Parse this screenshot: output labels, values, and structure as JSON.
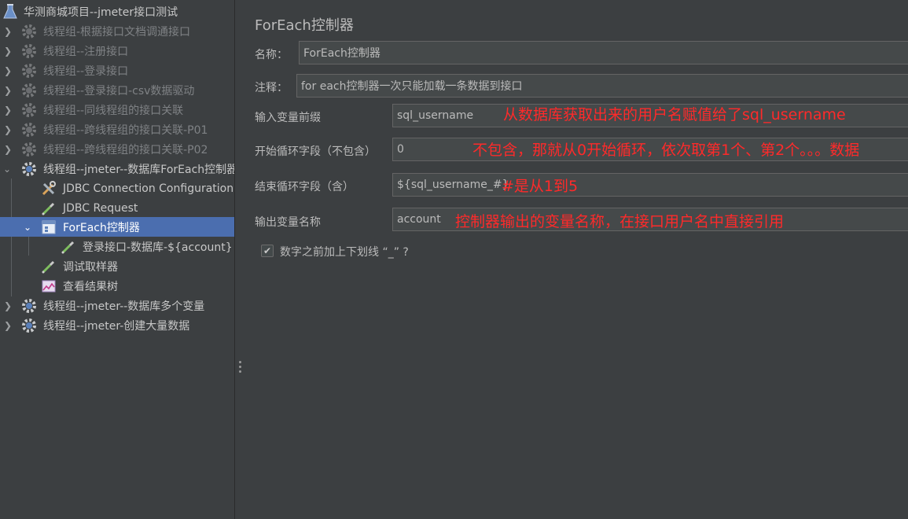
{
  "tree": {
    "root": "华测商城项目--jmeter接口测试",
    "thread_groups_top": [
      "线程组-根据接口文档调通接口",
      "线程组--注册接口",
      "线程组--登录接口",
      "线程组--登录接口-csv数据驱动",
      "线程组--同线程组的接口关联",
      "线程组--跨线程组的接口关联-P01",
      "线程组--跨线程组的接口关联-P02"
    ],
    "expanded_group": "线程组--jmeter--数据库ForEach控制器",
    "children": {
      "jdbc_config": "JDBC Connection Configuration",
      "jdbc_request": "JDBC Request",
      "foreach": "ForEach控制器",
      "login_sampler": "登录接口-数据库-${account}",
      "debug_sampler": "调试取样器",
      "result_tree": "查看结果树"
    },
    "thread_groups_bottom": [
      "线程组--jmeter--数据库多个变量",
      "线程组--jmeter-创建大量数据"
    ]
  },
  "panel": {
    "title": "ForEach控制器",
    "name_label": "名称：",
    "name_value": "ForEach控制器",
    "comment_label": "注释：",
    "comment_value": "for each控制器一次只能加载一条数据到接口",
    "input_prefix_label": "输入变量前缀",
    "input_prefix_value": "sql_username",
    "start_label": "开始循环字段（不包含）",
    "start_value": "0",
    "end_label": "结束循环字段（含）",
    "end_value": "${sql_username_#}",
    "output_label": "输出变量名称",
    "output_value": "account",
    "checkbox_label": "数字之前加上下划线 “_” ?",
    "checkbox_checked": true
  },
  "annotations": {
    "input_prefix": "从数据库获取出来的用户名赋值给了sql_username",
    "start": "不包含，那就从0开始循环，依次取第1个、第2个。。。数据",
    "end": "#是从1到5",
    "output": "控制器输出的变量名称，在接口用户名中直接引用"
  },
  "colors": {
    "background": "#3c3f41",
    "selection": "#4b6eaf",
    "annotation": "#ff2a2a",
    "field_bg": "#45494a"
  }
}
